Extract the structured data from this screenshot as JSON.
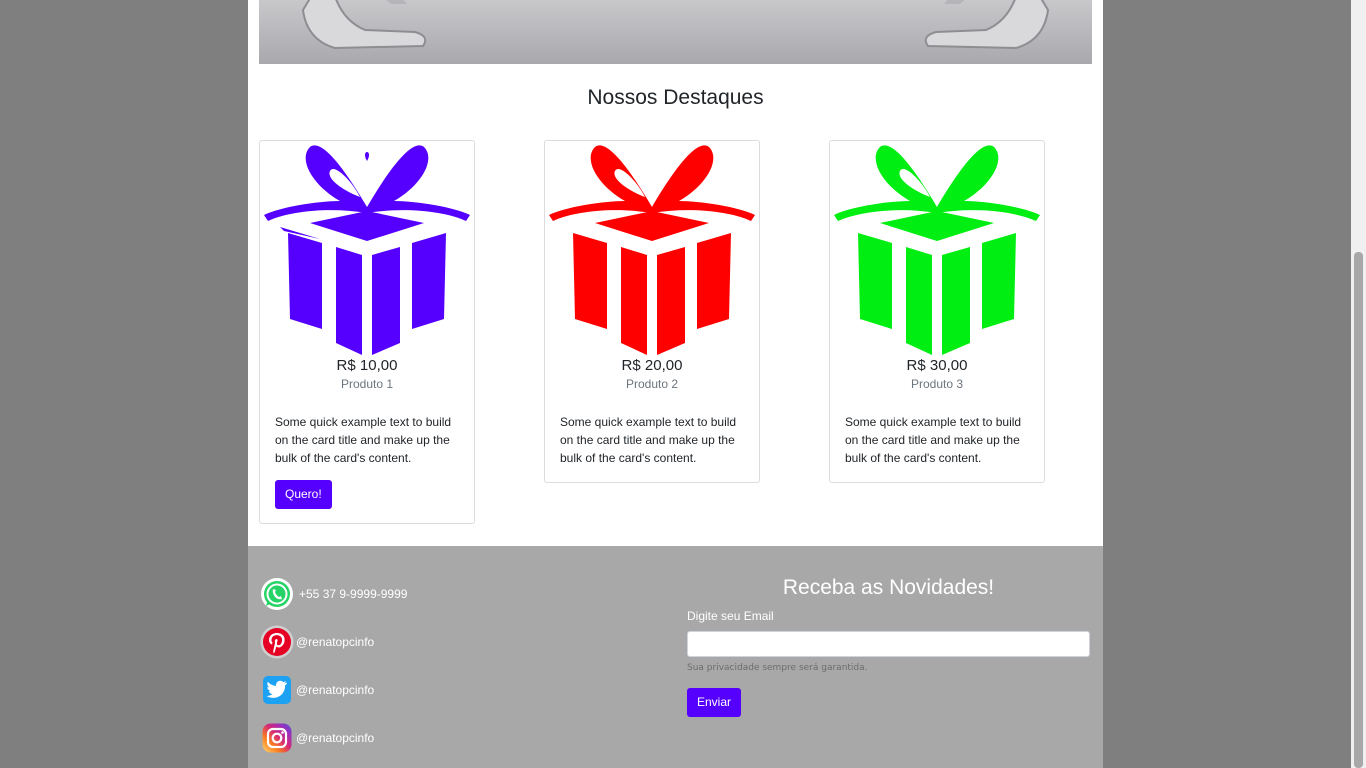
{
  "section": {
    "title": "Nossos Destaques"
  },
  "cards": [
    {
      "price": "R$ 10,00",
      "name": "Produto 1",
      "text": "Some quick example text to build on the card title and make up the bulk of the card's content.",
      "button": "Quero!",
      "color": "#5500ff"
    },
    {
      "price": "R$ 20,00",
      "name": "Produto 2",
      "text": "Some quick example text to build on the card title and make up the bulk of the card's content.",
      "color": "#ff0000"
    },
    {
      "price": "R$ 30,00",
      "name": "Produto 3",
      "text": "Some quick example text to build on the card title and make up the bulk of the card's content.",
      "color": "#00ee11"
    }
  ],
  "footer": {
    "social": [
      {
        "icon": "whatsapp-icon",
        "label": "+55 37 9-9999-9999"
      },
      {
        "icon": "pinterest-icon",
        "label": "@renatopcinfo"
      },
      {
        "icon": "twitter-icon",
        "label": "@renatopcinfo"
      },
      {
        "icon": "instagram-icon",
        "label": "@renatopcinfo"
      }
    ],
    "newsletter": {
      "title": "Receba as Novidades!",
      "email_label": "Digite seu Email",
      "email_value": "",
      "privacy": "Sua privacidade sempre será garantida.",
      "submit": "Enviar"
    }
  },
  "colors": {
    "accent": "#5500ff",
    "footer_bg": "#a8a8a8",
    "outer_bg": "#7f7f7f"
  }
}
